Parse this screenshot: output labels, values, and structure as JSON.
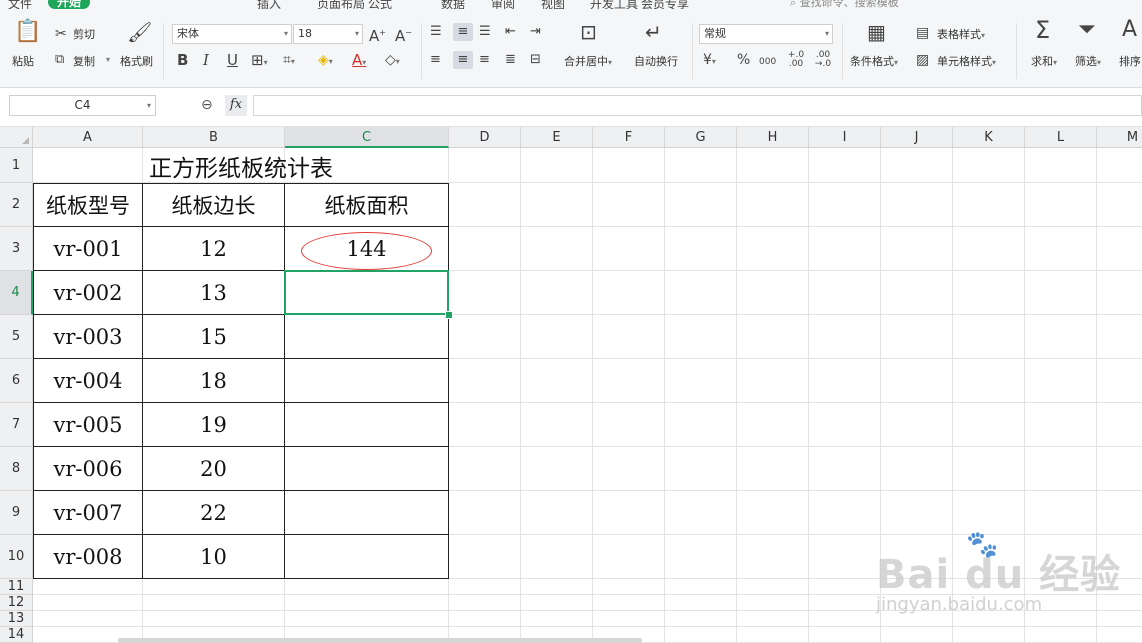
{
  "menu": {
    "items": [
      "文件",
      "开始",
      "插入",
      "页面布局",
      "公式",
      "数据",
      "审阅",
      "视图",
      "开发工具",
      "会员专享"
    ],
    "active": "开始",
    "search_placeholder": "查找命令、搜索模板",
    "accent_color": "#1ea75a"
  },
  "ribbon": {
    "paste_label": "粘贴",
    "cut_label": "剪切",
    "copy_label": "复制",
    "format_painter_label": "格式刷",
    "font_name": "宋体",
    "font_size": "18",
    "bold": "B",
    "italic": "I",
    "underline": "U",
    "merge_center_label": "合并居中",
    "wrap_text_label": "自动换行",
    "number_format": "常规",
    "currency_symbol": "¥",
    "percent_symbol": "%",
    "thousands_symbol": "000",
    "inc_decimal": "+.0 .00",
    "dec_decimal": ".00 →.0",
    "conditional_format_label": "条件格式",
    "table_style_label": "表格样式",
    "cell_style_label": "单元格样式",
    "sum_label": "求和",
    "filter_label": "筛选",
    "sort_label": "排序"
  },
  "formula_bar": {
    "name_box": "C4",
    "fx_label": "fx",
    "formula": ""
  },
  "sheet": {
    "columns": [
      "A",
      "B",
      "C",
      "D",
      "E",
      "F",
      "G",
      "H",
      "I",
      "J",
      "K",
      "L",
      "M"
    ],
    "rows": [
      "1",
      "2",
      "3",
      "4",
      "5",
      "6",
      "7",
      "8",
      "9",
      "10",
      "11",
      "12",
      "13",
      "14"
    ],
    "active_cell": "C4",
    "title": "正方形纸板统计表",
    "headers": [
      "纸板型号",
      "纸板边长",
      "纸板面积"
    ],
    "data": [
      [
        "vr-001",
        "12",
        "144"
      ],
      [
        "vr-002",
        "13",
        ""
      ],
      [
        "vr-003",
        "15",
        ""
      ],
      [
        "vr-004",
        "18",
        ""
      ],
      [
        "vr-005",
        "19",
        ""
      ],
      [
        "vr-006",
        "20",
        ""
      ],
      [
        "vr-007",
        "22",
        ""
      ],
      [
        "vr-008",
        "10",
        ""
      ]
    ],
    "highlight_color": "#e53935",
    "selection_color": "#21a366"
  },
  "watermark": {
    "logo_text": "Bai du 经验",
    "url": "jingyan.baidu.com"
  }
}
